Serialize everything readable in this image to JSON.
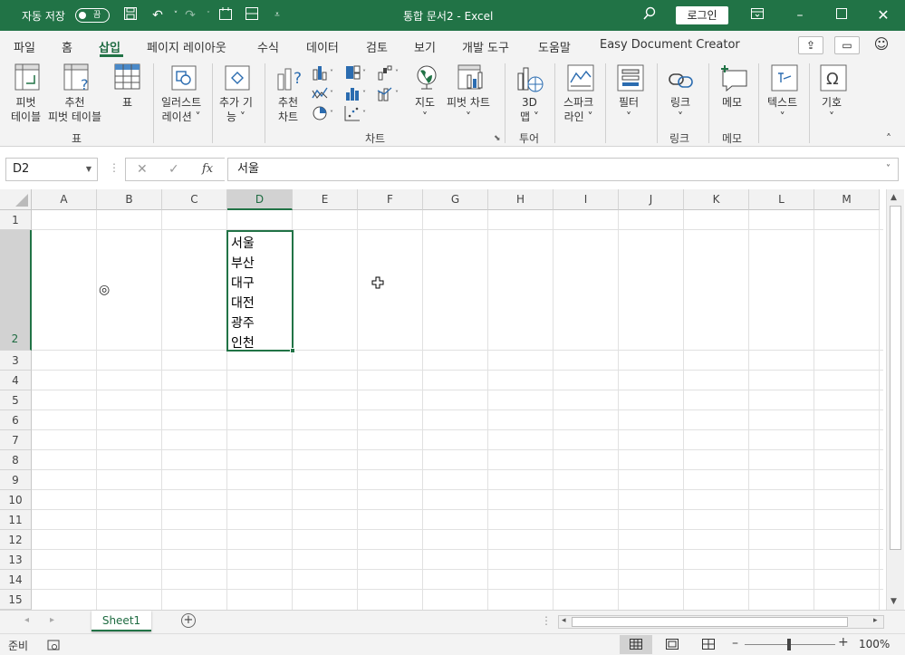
{
  "titlebar": {
    "autosave_label": "자동 저장",
    "autosave_state": "끔",
    "doc_title": "통합 문서2  -  Excel",
    "login": "로그인"
  },
  "tabs": [
    "파일",
    "홈",
    "삽입",
    "페이지 레이아웃",
    "수식",
    "데이터",
    "검토",
    "보기",
    "개발 도구",
    "도움말",
    "Easy Document Creator"
  ],
  "active_tab": "삽입",
  "ribbon": {
    "pivot_table": [
      "피벗",
      "테이블"
    ],
    "recommended_pivot": [
      "추천",
      "피벗 테이블"
    ],
    "table": "표",
    "group_table": "표",
    "illustrations": [
      "일러스트",
      "레이션 ˅"
    ],
    "addins": [
      "추가 기",
      "능 ˅"
    ],
    "recommended_charts": [
      "추천",
      "차트"
    ],
    "maps": [
      "지도",
      "˅"
    ],
    "pivot_chart": [
      "피벗 차트",
      "˅"
    ],
    "group_chart": "차트",
    "map3d": [
      "3D",
      "맵 ˅"
    ],
    "group_tour": "투어",
    "sparklines": [
      "스파크",
      "라인 ˅"
    ],
    "filter": [
      "필터",
      "˅"
    ],
    "link": [
      "링크",
      "˅"
    ],
    "group_link": "링크",
    "comment": "메모",
    "group_comment": "메모",
    "text": [
      "텍스트",
      "˅"
    ],
    "symbols": [
      "기호",
      "˅"
    ]
  },
  "formula_bar": {
    "name_box": "D2",
    "content": "서울"
  },
  "columns": [
    "A",
    "B",
    "C",
    "D",
    "E",
    "F",
    "G",
    "H",
    "I",
    "J",
    "K",
    "L",
    "M"
  ],
  "rows": [
    "1",
    "2",
    "3",
    "4",
    "5",
    "6",
    "7",
    "8",
    "9",
    "10",
    "11",
    "12",
    "13",
    "14",
    "15"
  ],
  "cell_D2_lines": [
    "서울",
    "부산",
    "대구",
    "대전",
    "광주",
    "인천"
  ],
  "cell_B2_symbol": "◎",
  "sheet_tab": "Sheet1",
  "status": {
    "ready": "준비",
    "zoom": "100%"
  },
  "colors": {
    "accent": "#217346"
  }
}
